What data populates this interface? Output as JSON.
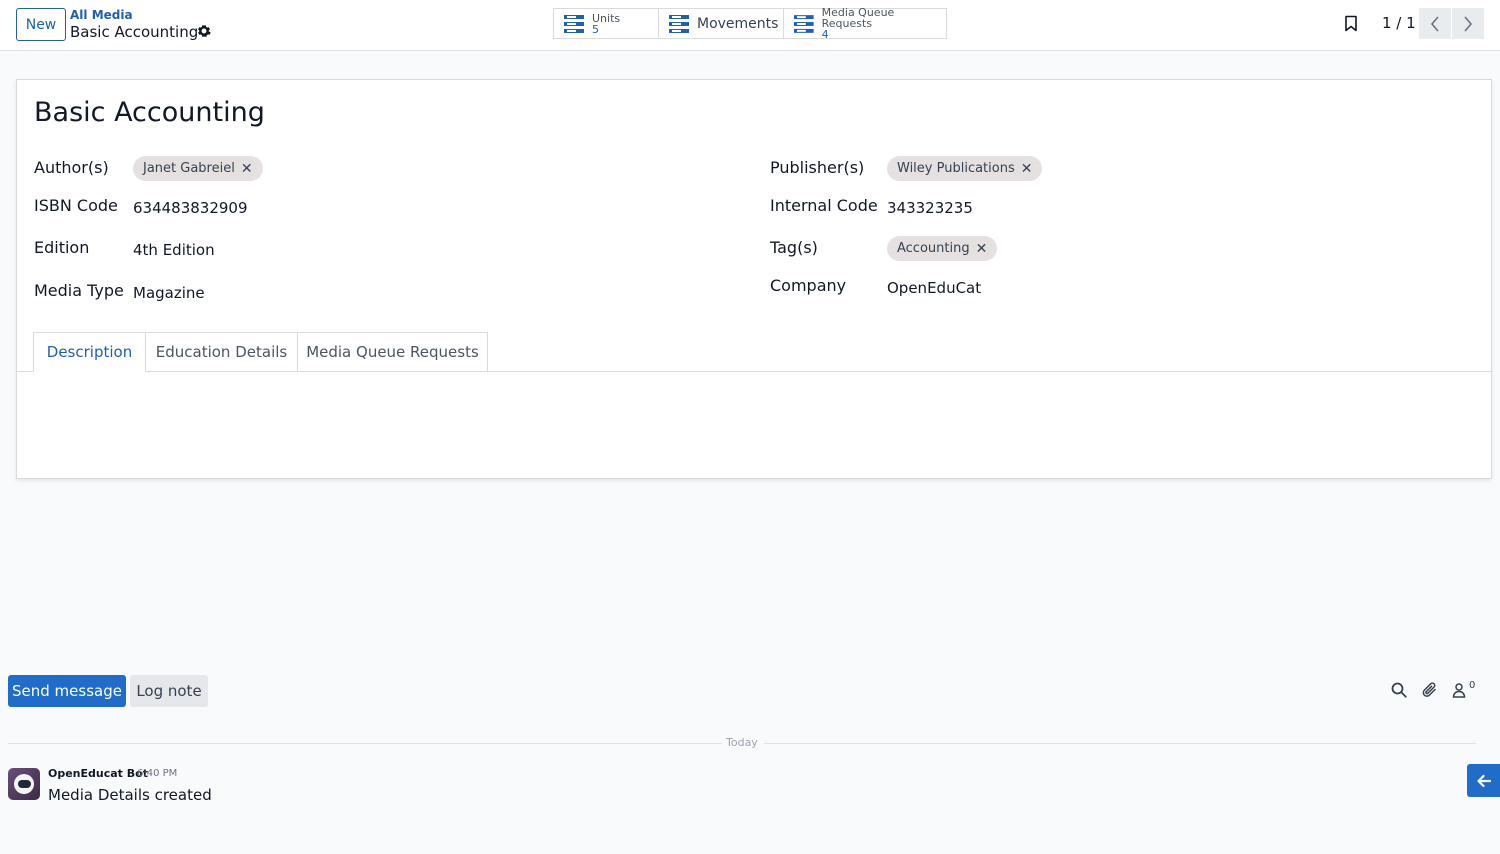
{
  "control_panel": {
    "new_label": "New",
    "breadcrumb_parent": "All Media",
    "breadcrumb_current": "Basic Accounting",
    "smart_buttons": {
      "units": {
        "label": "Units",
        "count": "5"
      },
      "movements": {
        "label": "Movements"
      },
      "queue": {
        "label": "Media Queue Requests",
        "count": "4"
      }
    },
    "pager": "1 / 1"
  },
  "form": {
    "title": "Basic Accounting",
    "left_fields": {
      "authors": {
        "label": "Author(s)",
        "tag": "Janet Gabreiel"
      },
      "isbn": {
        "label": "ISBN Code",
        "value": "634483832909"
      },
      "edition": {
        "label": "Edition",
        "value": "4th Edition"
      },
      "media_type": {
        "label": "Media Type",
        "value": "Magazine"
      }
    },
    "right_fields": {
      "publishers": {
        "label": "Publisher(s)",
        "tag": "Wiley Publications"
      },
      "internal_code": {
        "label": "Internal Code",
        "value": "343323235"
      },
      "tags": {
        "label": "Tag(s)",
        "tag": "Accounting"
      },
      "company": {
        "label": "Company",
        "value": "OpenEduCat"
      }
    },
    "tabs": [
      "Description",
      "Education Details",
      "Media Queue Requests"
    ],
    "tag_remove_glyph": "✕"
  },
  "chatter": {
    "send_label": "Send message",
    "log_label": "Log note",
    "followers_count": "0",
    "date_divider": "Today",
    "messages": [
      {
        "author": "OpenEducat Bot",
        "time": "6:40 PM",
        "body": "Media Details created"
      }
    ]
  },
  "colors": {
    "primary": "#1f5fb4",
    "button_primary": "#1f6cc9",
    "tag_bg": "#e6e1e1"
  },
  "icons": [
    "gear-icon",
    "list-icon",
    "bookmark-icon",
    "chevron-left-icon",
    "chevron-right-icon",
    "search-icon",
    "paperclip-icon",
    "follower-icon",
    "arrow-left-icon"
  ]
}
